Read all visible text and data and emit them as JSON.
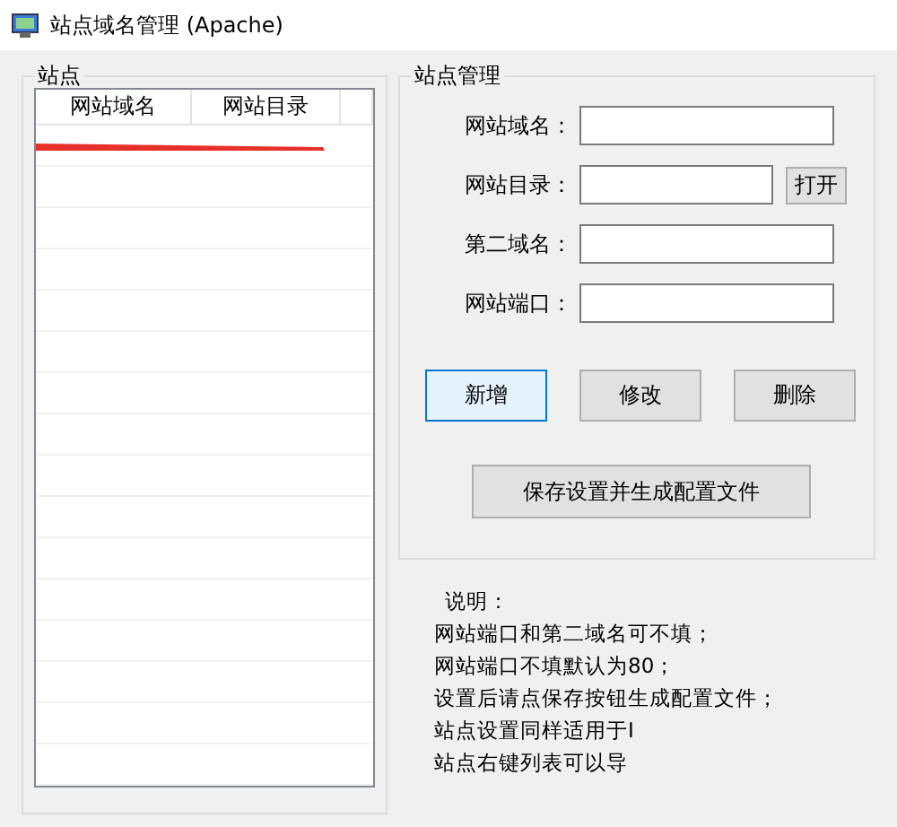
{
  "window": {
    "title": "站点域名管理 (Apache)"
  },
  "sites": {
    "title": "站点",
    "columns": [
      "网站域名",
      "网站目录"
    ],
    "rows": [
      {
        "redacted": true
      },
      {
        "redacted": false
      },
      {
        "redacted": false
      },
      {
        "redacted": false
      },
      {
        "redacted": false
      },
      {
        "redacted": false
      },
      {
        "redacted": false
      },
      {
        "redacted": false
      },
      {
        "redacted": false
      },
      {
        "redacted": false
      },
      {
        "redacted": false
      },
      {
        "redacted": false
      },
      {
        "redacted": false
      },
      {
        "redacted": false
      },
      {
        "redacted": false
      },
      {
        "redacted": false
      }
    ]
  },
  "manage": {
    "title": "站点管理",
    "fields": [
      {
        "label": "网站域名：",
        "kind": "text"
      },
      {
        "label": "网站目录：",
        "kind": "browse",
        "button": "打开"
      },
      {
        "label": "第二域名：",
        "kind": "text"
      },
      {
        "label": "网站端口：",
        "kind": "text"
      }
    ],
    "actions": [
      {
        "label": "新增",
        "selected": true
      },
      {
        "label": "修改",
        "selected": false
      },
      {
        "label": "删除",
        "selected": false
      }
    ],
    "save": "保存设置并生成配置文件"
  },
  "notes": [
    "说明：",
    "网站端口和第二域名可不填；",
    "网站端口不填默认为80；",
    "设置后请点保存按钮生成配置文件；",
    "站点设置同样适用于I",
    "站点右键列表可以导"
  ]
}
